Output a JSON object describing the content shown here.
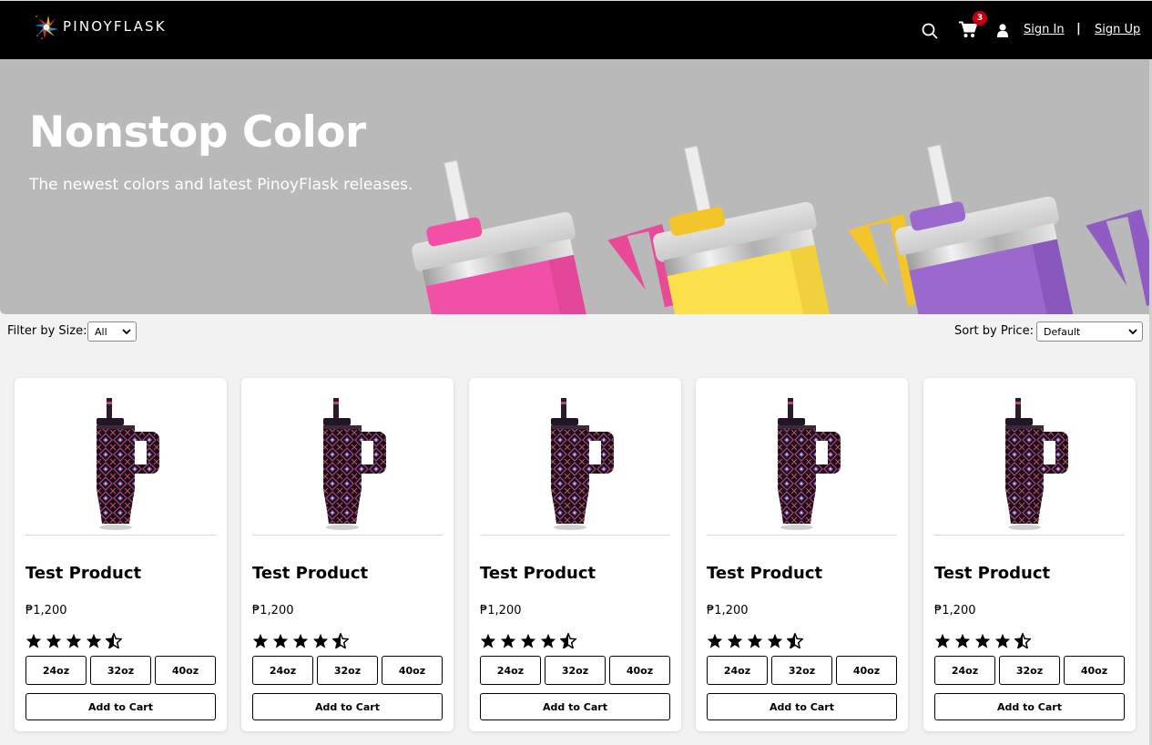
{
  "header": {
    "logo_text": "PINOYFLASK",
    "cart_count": "3",
    "sign_in": "Sign In",
    "separator": "|",
    "sign_up": "Sign Up",
    "icons": [
      "search-icon",
      "cart-icon",
      "user-icon"
    ]
  },
  "hero": {
    "title": "Nonstop Color",
    "subtitle": "The newest colors and latest PinoyFlask releases.",
    "tumbler_colors": [
      "#f24fa6",
      "#fbe04a",
      "#9b68cd"
    ]
  },
  "filters": {
    "size_label": "Filter by Size:",
    "size_value": "All",
    "sort_label": "Sort by Price:",
    "sort_value": "Default"
  },
  "products": [
    {
      "name": "Test Product",
      "price": "₱1,200",
      "rating": 4.5,
      "sizes": [
        "24oz",
        "32oz",
        "40oz"
      ],
      "cta": "Add to Cart"
    },
    {
      "name": "Test Product",
      "price": "₱1,200",
      "rating": 4.5,
      "sizes": [
        "24oz",
        "32oz",
        "40oz"
      ],
      "cta": "Add to Cart"
    },
    {
      "name": "Test Product",
      "price": "₱1,200",
      "rating": 4.5,
      "sizes": [
        "24oz",
        "32oz",
        "40oz"
      ],
      "cta": "Add to Cart"
    },
    {
      "name": "Test Product",
      "price": "₱1,200",
      "rating": 4.5,
      "sizes": [
        "24oz",
        "32oz",
        "40oz"
      ],
      "cta": "Add to Cart"
    },
    {
      "name": "Test Product",
      "price": "₱1,200",
      "rating": 4.5,
      "sizes": [
        "24oz",
        "32oz",
        "40oz"
      ],
      "cta": "Add to Cart"
    }
  ],
  "colors": {
    "header_bg": "#000000",
    "hero_bg": "#b9b9b9",
    "page_bg": "#f2f2f2",
    "badge": "#c40010"
  }
}
